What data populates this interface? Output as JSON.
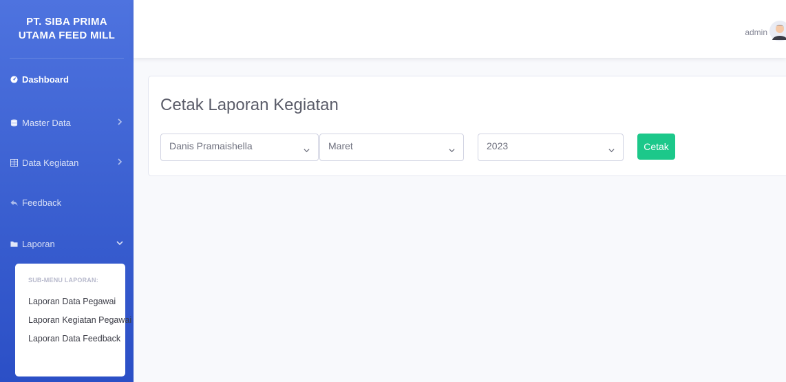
{
  "brand": {
    "line1": "PT. SIBA PRIMA",
    "line2": "UTAMA FEED MILL"
  },
  "sidebar": {
    "items": [
      {
        "label": "Dashboard",
        "icon": "tachometer-icon"
      },
      {
        "label": "Master Data",
        "icon": "database-icon"
      },
      {
        "label": "Data Kegiatan",
        "icon": "table-icon"
      },
      {
        "label": "Feedback",
        "icon": "reply-icon"
      },
      {
        "label": "Laporan",
        "icon": "folder-icon"
      }
    ],
    "submenu": {
      "header": "SUB-MENU LAPORAN:",
      "items": [
        "Laporan Data Pegawai",
        "Laporan Kegiatan Pegawai",
        "Laporan Data Feedback"
      ]
    }
  },
  "topbar": {
    "username": "admin"
  },
  "main": {
    "title": "Cetak Laporan Kegiatan",
    "employee_select": "Danis Pramaishella",
    "month_select": "Maret",
    "year_select": "2023",
    "print_button": "Cetak"
  },
  "colors": {
    "sidebar": "#4e73df",
    "success": "#1cc88a",
    "background": "#f8f9fc"
  }
}
